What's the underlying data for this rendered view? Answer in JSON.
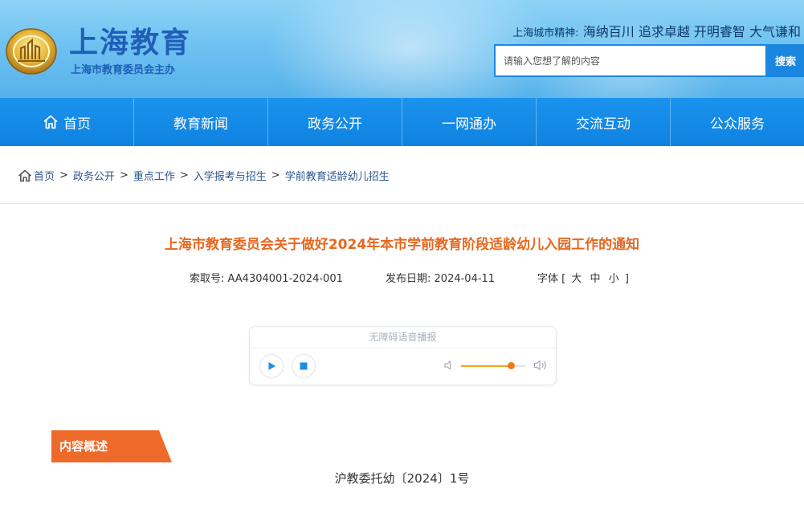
{
  "header": {
    "site_title": "上海教育",
    "site_subtitle": "上海市教育委员会主办",
    "spirit_label": "上海城市精神:",
    "spirit_text": "海纳百川 追求卓越 开明睿智 大气谦和",
    "search_placeholder": "请输入您想了解的内容",
    "search_button": "搜索"
  },
  "nav": {
    "items": [
      {
        "label": "首页"
      },
      {
        "label": "教育新闻"
      },
      {
        "label": "政务公开"
      },
      {
        "label": "一网通办"
      },
      {
        "label": "交流互动"
      },
      {
        "label": "公众服务"
      }
    ]
  },
  "breadcrumb": {
    "items": [
      "首页",
      "政务公开",
      "重点工作",
      "入学报考与招生",
      "学前教育适龄幼儿招生"
    ],
    "separator": ">"
  },
  "article": {
    "title": "上海市教育委员会关于做好2024年本市学前教育阶段适龄幼儿入园工作的通知",
    "index_label": "索取号:",
    "index_value": "AA4304001-2024-001",
    "date_label": "发布日期:",
    "date_value": "2024-04-11",
    "font_label": "字体",
    "font_open": "[",
    "font_large": "大",
    "font_medium": "中",
    "font_small": "小",
    "font_close": "]"
  },
  "player": {
    "title": "无障碍语音播报",
    "volume": 0.78,
    "icons": [
      "play-icon",
      "stop-icon",
      "volume-low-icon",
      "volume-high-icon"
    ]
  },
  "content": {
    "section_label": "内容概述",
    "doc_number": "沪教委托幼〔2024〕1号"
  },
  "colors": {
    "primary_blue": "#1b86e0",
    "title_orange": "#e8671e",
    "section_orange": "#ee6a2a"
  }
}
